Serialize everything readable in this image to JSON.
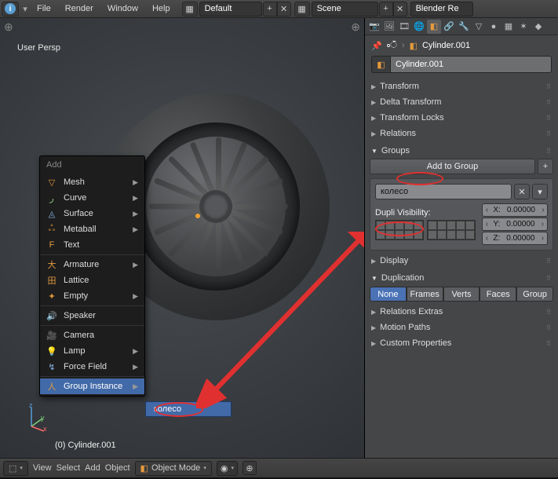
{
  "topbar": {
    "menus": [
      "File",
      "Render",
      "Window",
      "Help"
    ],
    "layout": "Default",
    "scene_label": "Scene",
    "engine": "Blender Re"
  },
  "viewport": {
    "persp_label": "User Persp",
    "object_footer": "(0) Cylinder.001",
    "axes": {
      "x": "x",
      "y": "y",
      "z": "z"
    }
  },
  "addmenu": {
    "title": "Add",
    "items_a": [
      {
        "icon": "▽",
        "label": "Mesh",
        "sub": true
      },
      {
        "icon": "ر",
        "label": "Curve",
        "sub": true,
        "ic": "grn"
      },
      {
        "icon": "◬",
        "label": "Surface",
        "sub": true,
        "ic": "blue"
      },
      {
        "icon": "ஃ",
        "label": "Metaball",
        "sub": true
      },
      {
        "icon": "F",
        "label": "Text"
      }
    ],
    "items_b": [
      {
        "icon": "大",
        "label": "Armature",
        "sub": true
      },
      {
        "icon": "田",
        "label": "Lattice"
      },
      {
        "icon": "✦",
        "label": "Empty",
        "sub": true
      }
    ],
    "items_c": [
      {
        "icon": "🔊",
        "label": "Speaker",
        "ic": "blue"
      }
    ],
    "items_d": [
      {
        "icon": "🎥",
        "label": "Camera"
      },
      {
        "icon": "💡",
        "label": "Lamp",
        "sub": true
      },
      {
        "icon": "↯",
        "label": "Force Field",
        "sub": true,
        "ic": "blue"
      }
    ],
    "items_e": [
      {
        "icon": "人",
        "label": "Group Instance",
        "sub": true,
        "sel": true
      }
    ],
    "submenu_item": "колесо"
  },
  "vpfooter": {
    "menus": [
      "View",
      "Select",
      "Add",
      "Object"
    ],
    "mode": "Object Mode"
  },
  "props": {
    "breadcrumb": "Cylinder.001",
    "name": "Cylinder.001",
    "sections_closed": [
      "Transform",
      "Delta Transform",
      "Transform Locks",
      "Relations"
    ],
    "groups": {
      "title": "Groups",
      "add_btn": "Add to Group",
      "group_name": "колесо",
      "dv_label": "Dupli Visibility:",
      "x": {
        "label": "X:",
        "val": "0.00000"
      },
      "y": {
        "label": "Y:",
        "val": "0.00000"
      },
      "z": {
        "label": "Z:",
        "val": "0.00000"
      }
    },
    "display_title": "Display",
    "dup": {
      "title": "Duplication",
      "buttons": [
        "None",
        "Frames",
        "Verts",
        "Faces",
        "Group"
      ]
    },
    "tail": [
      "Relations Extras",
      "Motion Paths",
      "Custom Properties"
    ]
  }
}
